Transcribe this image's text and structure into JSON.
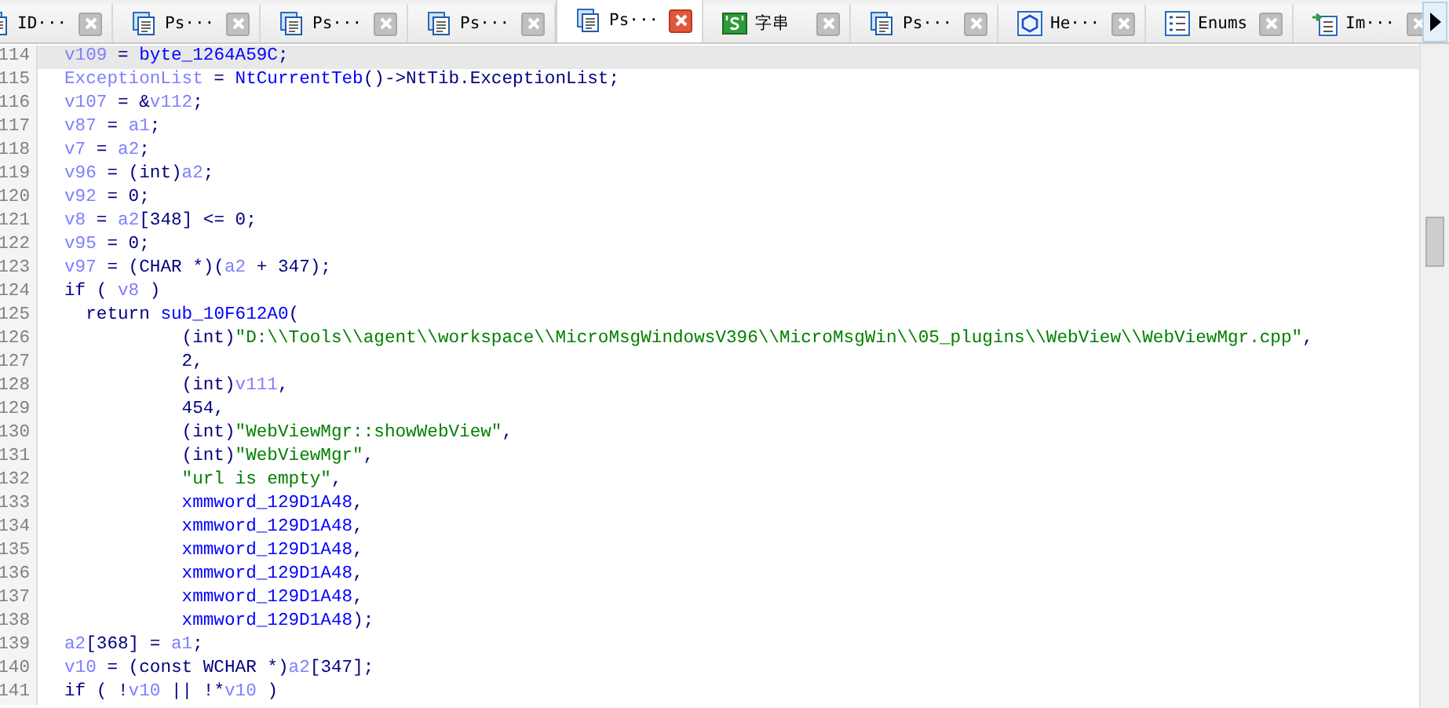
{
  "tabs": [
    {
      "label": "ID···",
      "kind": "disasm",
      "selected": false
    },
    {
      "label": "Ps···",
      "kind": "pseudo",
      "selected": false
    },
    {
      "label": "Ps···",
      "kind": "pseudo",
      "selected": false
    },
    {
      "label": "Ps···",
      "kind": "pseudo",
      "selected": false
    },
    {
      "label": "Ps···",
      "kind": "pseudo",
      "selected": true
    },
    {
      "label": "字串",
      "kind": "strings",
      "selected": false
    },
    {
      "label": "Ps···",
      "kind": "pseudo",
      "selected": false
    },
    {
      "label": "He···",
      "kind": "hex",
      "selected": false
    },
    {
      "label": "Enums",
      "kind": "enums",
      "selected": false
    },
    {
      "label": "Im···",
      "kind": "imports",
      "selected": false
    }
  ],
  "code": {
    "lines": [
      {
        "number": "114",
        "selected": true,
        "tokens": [
          {
            "kind": "var",
            "text": "v109"
          },
          {
            "kind": "plain",
            "text": " = "
          },
          {
            "kind": "name",
            "text": "byte_1264A59C"
          },
          {
            "kind": "plain",
            "text": ";"
          }
        ]
      },
      {
        "number": "115",
        "selected": false,
        "tokens": [
          {
            "kind": "var",
            "text": "ExceptionList"
          },
          {
            "kind": "plain",
            "text": " = "
          },
          {
            "kind": "name",
            "text": "NtCurrentTeb"
          },
          {
            "kind": "plain",
            "text": "()->NtTib.ExceptionList;"
          }
        ]
      },
      {
        "number": "116",
        "selected": false,
        "tokens": [
          {
            "kind": "var",
            "text": "v107"
          },
          {
            "kind": "plain",
            "text": " = &"
          },
          {
            "kind": "var",
            "text": "v112"
          },
          {
            "kind": "plain",
            "text": ";"
          }
        ]
      },
      {
        "number": "117",
        "selected": false,
        "tokens": [
          {
            "kind": "var",
            "text": "v87"
          },
          {
            "kind": "plain",
            "text": " = "
          },
          {
            "kind": "var",
            "text": "a1"
          },
          {
            "kind": "plain",
            "text": ";"
          }
        ]
      },
      {
        "number": "118",
        "selected": false,
        "tokens": [
          {
            "kind": "var",
            "text": "v7"
          },
          {
            "kind": "plain",
            "text": " = "
          },
          {
            "kind": "var",
            "text": "a2"
          },
          {
            "kind": "plain",
            "text": ";"
          }
        ]
      },
      {
        "number": "119",
        "selected": false,
        "tokens": [
          {
            "kind": "var",
            "text": "v96"
          },
          {
            "kind": "plain",
            "text": " = (int)"
          },
          {
            "kind": "var",
            "text": "a2"
          },
          {
            "kind": "plain",
            "text": ";"
          }
        ]
      },
      {
        "number": "120",
        "selected": false,
        "tokens": [
          {
            "kind": "var",
            "text": "v92"
          },
          {
            "kind": "plain",
            "text": " = 0;"
          }
        ]
      },
      {
        "number": "121",
        "selected": false,
        "tokens": [
          {
            "kind": "var",
            "text": "v8"
          },
          {
            "kind": "plain",
            "text": " = "
          },
          {
            "kind": "var",
            "text": "a2"
          },
          {
            "kind": "plain",
            "text": "[348] <= 0;"
          }
        ]
      },
      {
        "number": "122",
        "selected": false,
        "tokens": [
          {
            "kind": "var",
            "text": "v95"
          },
          {
            "kind": "plain",
            "text": " = 0;"
          }
        ]
      },
      {
        "number": "123",
        "selected": false,
        "tokens": [
          {
            "kind": "var",
            "text": "v97"
          },
          {
            "kind": "plain",
            "text": " = (CHAR *)("
          },
          {
            "kind": "var",
            "text": "a2"
          },
          {
            "kind": "plain",
            "text": " + 347);"
          }
        ]
      },
      {
        "number": "124",
        "selected": false,
        "tokens": [
          {
            "kind": "plain",
            "text": "if ( "
          },
          {
            "kind": "var",
            "text": "v8"
          },
          {
            "kind": "plain",
            "text": " )"
          }
        ]
      },
      {
        "number": "125",
        "selected": false,
        "tokens": [
          {
            "kind": "plain",
            "text": "  return "
          },
          {
            "kind": "name",
            "text": "sub_10F612A0"
          },
          {
            "kind": "plain",
            "text": "("
          }
        ]
      },
      {
        "number": "126",
        "selected": false,
        "tokens": [
          {
            "kind": "plain",
            "text": "           (int)"
          },
          {
            "kind": "string",
            "text": "\"D:\\\\Tools\\\\agent\\\\workspace\\\\MicroMsgWindowsV396\\\\MicroMsgWin\\\\05_plugins\\\\WebView\\\\WebViewMgr.cpp\""
          },
          {
            "kind": "plain",
            "text": ","
          }
        ]
      },
      {
        "number": "127",
        "selected": false,
        "tokens": [
          {
            "kind": "plain",
            "text": "           2,"
          }
        ]
      },
      {
        "number": "128",
        "selected": false,
        "tokens": [
          {
            "kind": "plain",
            "text": "           (int)"
          },
          {
            "kind": "var",
            "text": "v111"
          },
          {
            "kind": "plain",
            "text": ","
          }
        ]
      },
      {
        "number": "129",
        "selected": false,
        "tokens": [
          {
            "kind": "plain",
            "text": "           454,"
          }
        ]
      },
      {
        "number": "130",
        "selected": false,
        "tokens": [
          {
            "kind": "plain",
            "text": "           (int)"
          },
          {
            "kind": "string",
            "text": "\"WebViewMgr::showWebView\""
          },
          {
            "kind": "plain",
            "text": ","
          }
        ]
      },
      {
        "number": "131",
        "selected": false,
        "tokens": [
          {
            "kind": "plain",
            "text": "           (int)"
          },
          {
            "kind": "string",
            "text": "\"WebViewMgr\""
          },
          {
            "kind": "plain",
            "text": ","
          }
        ]
      },
      {
        "number": "132",
        "selected": false,
        "tokens": [
          {
            "kind": "string",
            "text": "           \"url is empty\""
          },
          {
            "kind": "plain",
            "text": ","
          }
        ]
      },
      {
        "number": "133",
        "selected": false,
        "tokens": [
          {
            "kind": "name",
            "text": "           xmmword_129D1A48"
          },
          {
            "kind": "plain",
            "text": ","
          }
        ]
      },
      {
        "number": "134",
        "selected": false,
        "tokens": [
          {
            "kind": "name",
            "text": "           xmmword_129D1A48"
          },
          {
            "kind": "plain",
            "text": ","
          }
        ]
      },
      {
        "number": "135",
        "selected": false,
        "tokens": [
          {
            "kind": "name",
            "text": "           xmmword_129D1A48"
          },
          {
            "kind": "plain",
            "text": ","
          }
        ]
      },
      {
        "number": "136",
        "selected": false,
        "tokens": [
          {
            "kind": "name",
            "text": "           xmmword_129D1A48"
          },
          {
            "kind": "plain",
            "text": ","
          }
        ]
      },
      {
        "number": "137",
        "selected": false,
        "tokens": [
          {
            "kind": "name",
            "text": "           xmmword_129D1A48"
          },
          {
            "kind": "plain",
            "text": ","
          }
        ]
      },
      {
        "number": "138",
        "selected": false,
        "tokens": [
          {
            "kind": "name",
            "text": "           xmmword_129D1A48"
          },
          {
            "kind": "plain",
            "text": ");"
          }
        ]
      },
      {
        "number": "139",
        "selected": false,
        "tokens": [
          {
            "kind": "var",
            "text": "a2"
          },
          {
            "kind": "plain",
            "text": "[368] = "
          },
          {
            "kind": "var",
            "text": "a1"
          },
          {
            "kind": "plain",
            "text": ";"
          }
        ]
      },
      {
        "number": "140",
        "selected": false,
        "tokens": [
          {
            "kind": "var",
            "text": "v10"
          },
          {
            "kind": "plain",
            "text": " = (const WCHAR *)"
          },
          {
            "kind": "var",
            "text": "a2"
          },
          {
            "kind": "plain",
            "text": "[347];"
          }
        ]
      },
      {
        "number": "141",
        "selected": false,
        "tokens": [
          {
            "kind": "plain",
            "text": "if ( !"
          },
          {
            "kind": "var",
            "text": "v10"
          },
          {
            "kind": "plain",
            "text": " || !*"
          },
          {
            "kind": "var",
            "text": "v10"
          },
          {
            "kind": "plain",
            "text": " )"
          }
        ]
      }
    ]
  }
}
